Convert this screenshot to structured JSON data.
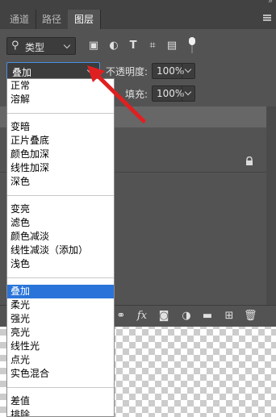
{
  "tabs": [
    {
      "label": "通道",
      "active": false
    },
    {
      "label": "路径",
      "active": false
    },
    {
      "label": "图层",
      "active": true
    }
  ],
  "filter": {
    "kind_label": "类型",
    "icons": [
      "image-filter-icon",
      "adjustment-filter-icon",
      "type-filter-icon",
      "shape-filter-icon",
      "smart-object-filter-icon"
    ]
  },
  "blend": {
    "current": "叠加",
    "opacity_label": "不透明度:",
    "opacity_value": "100%",
    "fill_label": "填充:",
    "fill_value": "100%"
  },
  "menu": {
    "items": [
      {
        "label": "正常"
      },
      {
        "label": "溶解"
      },
      {
        "sep": true
      },
      {
        "label": "变暗"
      },
      {
        "label": "正片叠底"
      },
      {
        "label": "颜色加深"
      },
      {
        "label": "线性加深"
      },
      {
        "label": "深色"
      },
      {
        "sep": true
      },
      {
        "label": "变亮"
      },
      {
        "label": "滤色"
      },
      {
        "label": "颜色减淡"
      },
      {
        "label": "线性减淡（添加）"
      },
      {
        "label": "浅色"
      },
      {
        "sep": true
      },
      {
        "label": "叠加",
        "selected": true
      },
      {
        "label": "柔光"
      },
      {
        "label": "强光"
      },
      {
        "label": "亮光"
      },
      {
        "label": "线性光"
      },
      {
        "label": "点光"
      },
      {
        "label": "实色混合"
      },
      {
        "sep": true
      },
      {
        "label": "差值"
      },
      {
        "label": "排除"
      }
    ]
  },
  "bottom_bar": {
    "icons": [
      "link-layers-icon",
      "fx-icon",
      "add-mask-icon",
      "adjustment-layer-icon",
      "new-group-icon",
      "new-layer-icon",
      "delete-layer-icon"
    ],
    "fx_label": "fx"
  },
  "colors": {
    "panel_bg": "#535353",
    "selected_item": "#2a74d9",
    "arrow": "#e02020"
  }
}
